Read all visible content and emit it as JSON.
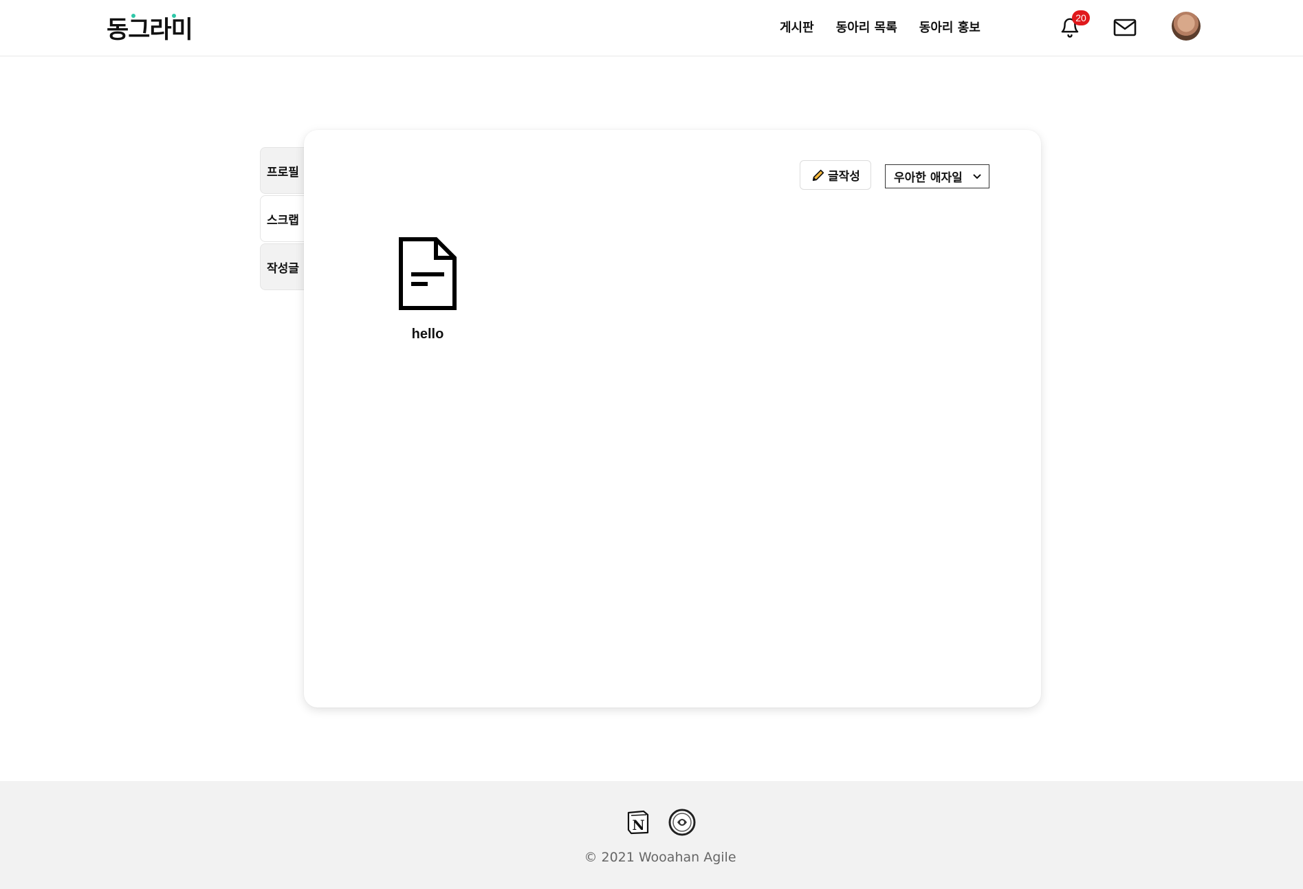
{
  "header": {
    "logo_text": "동그라미",
    "nav": [
      "게시판",
      "동아리 목록",
      "동아리 홍보"
    ],
    "notification_count": "20",
    "accent_color": "#2fc7a8",
    "badge_color": "#e0191c"
  },
  "side_tabs": [
    {
      "label": "프로필",
      "active": false
    },
    {
      "label": "스크랩",
      "active": true
    },
    {
      "label": "작성글",
      "active": false
    }
  ],
  "toolbar": {
    "write_label": "글작성",
    "club_select_value": "우아한 애자일"
  },
  "posts": [
    {
      "title": "hello",
      "icon": "document-icon"
    }
  ],
  "footer": {
    "icons": [
      "notion-icon",
      "club-logo-icon"
    ],
    "copyright": "© 2021 Wooahan Agile"
  }
}
